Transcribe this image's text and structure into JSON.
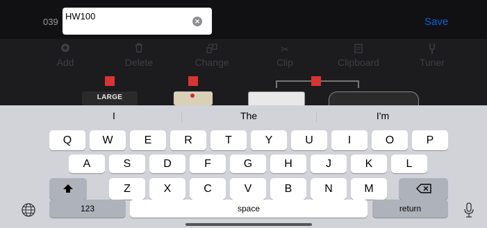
{
  "header": {
    "patch_number": "039",
    "patch_name": "HW100",
    "save_label": "Save"
  },
  "toolbar": {
    "items": [
      {
        "label": "Add",
        "icon": "add-icon"
      },
      {
        "label": "Delete",
        "icon": "trash-icon"
      },
      {
        "label": "Change",
        "icon": "swap-icon"
      },
      {
        "label": "Clip",
        "icon": "scissors-icon"
      },
      {
        "label": "Clipboard",
        "icon": "clipboard-icon"
      },
      {
        "label": "Tuner",
        "icon": "tuner-fork-icon"
      }
    ]
  },
  "chain": {
    "amp_label": "LARGE CHAPEL"
  },
  "keyboard": {
    "suggestions": [
      "I",
      "The",
      "I'm"
    ],
    "row1": [
      "Q",
      "W",
      "E",
      "R",
      "T",
      "Y",
      "U",
      "I",
      "O",
      "P"
    ],
    "row2": [
      "A",
      "S",
      "D",
      "F",
      "G",
      "H",
      "J",
      "K",
      "L"
    ],
    "row3": [
      "Z",
      "X",
      "C",
      "V",
      "B",
      "N",
      "M"
    ],
    "numbers_label": "123",
    "space_label": "space",
    "return_label": "return"
  },
  "colors": {
    "accent": "#0a63d6",
    "block_enabled": "#d93434"
  }
}
